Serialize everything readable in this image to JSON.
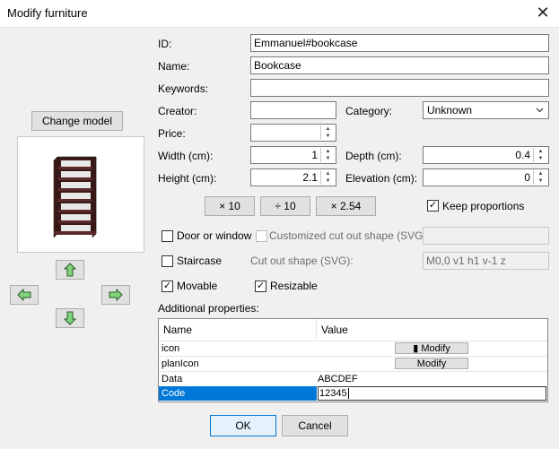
{
  "window": {
    "title": "Modify furniture",
    "close_glyph": "✕"
  },
  "left": {
    "change_model_label": "Change model",
    "nav": {
      "up": "arrow-up",
      "down": "arrow-down",
      "left": "arrow-left",
      "right": "arrow-right"
    }
  },
  "form": {
    "id_label": "ID:",
    "id_value": "Emmanuel#bookcase",
    "name_label": "Name:",
    "name_value": "Bookcase",
    "keywords_label": "Keywords:",
    "keywords_value": "",
    "creator_label": "Creator:",
    "creator_value": "",
    "category_label": "Category:",
    "category_value": "Unknown",
    "price_label": "Price:",
    "price_value": "",
    "width_label": "Width (cm):",
    "width_value": "1",
    "depth_label": "Depth (cm):",
    "depth_value": "0.4",
    "height_label": "Height (cm):",
    "height_value": "2.1",
    "elevation_label": "Elevation (cm):",
    "elevation_value": "0"
  },
  "scale_buttons": {
    "times10": "× 10",
    "div10": "÷ 10",
    "times254": "× 2.54"
  },
  "checks": {
    "keep_proportions": {
      "label": "Keep proportions",
      "checked": true
    },
    "door_or_window": {
      "label": "Door or window",
      "checked": false
    },
    "customized_cut_out": {
      "label": "Customized cut out shape (SVG):",
      "checked": false
    },
    "staircase": {
      "label": "Staircase",
      "checked": false
    },
    "cut_out_shape_label": "Cut out shape (SVG):",
    "cut_out_shape_value": "M0,0 v1 h1 v-1 z",
    "movable": {
      "label": "Movable",
      "checked": true
    },
    "resizable": {
      "label": "Resizable",
      "checked": true
    },
    "check_glyph": "✓"
  },
  "properties": {
    "section_label": "Additional properties:",
    "columns": [
      "Name",
      "Value"
    ],
    "rows": [
      {
        "name": "icon",
        "value": "",
        "button": "Modify",
        "button_icon": "▮"
      },
      {
        "name": "planIcon",
        "value": "",
        "button": "Modify"
      },
      {
        "name": "Data",
        "value": "ABCDEF"
      },
      {
        "name": "Code",
        "value": "12345"
      }
    ]
  },
  "footer": {
    "ok": "OK",
    "cancel": "Cancel"
  },
  "colors": {
    "selection": "#0078d7",
    "nav_arrow": "#7fd37a",
    "bookcase": "#3a1a1a"
  }
}
